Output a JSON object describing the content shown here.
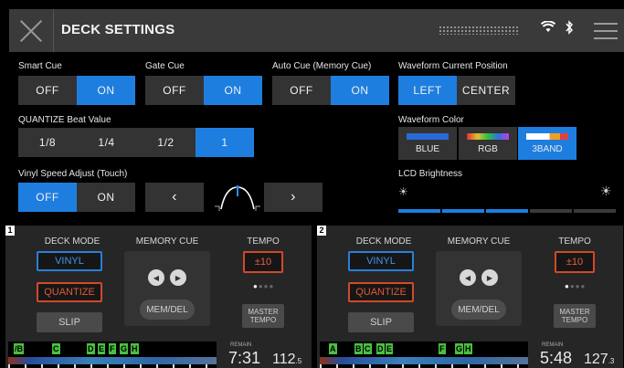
{
  "header": {
    "title": "DECK SETTINGS",
    "wifi_icon": "wifi-icon",
    "bluetooth_icon": "bluetooth-icon",
    "menu_icon": "menu-icon"
  },
  "settings": {
    "smart_cue": {
      "label": "Smart Cue",
      "options": [
        "OFF",
        "ON"
      ],
      "selected": "ON"
    },
    "gate_cue": {
      "label": "Gate Cue",
      "options": [
        "OFF",
        "ON"
      ],
      "selected": "ON"
    },
    "auto_cue": {
      "label": "Auto Cue (Memory Cue)",
      "options": [
        "OFF",
        "ON"
      ],
      "selected": "ON"
    },
    "waveform_position": {
      "label": "Waveform Current Position",
      "options": [
        "LEFT",
        "CENTER"
      ],
      "selected": "LEFT"
    },
    "quantize": {
      "label": "QUANTIZE Beat Value",
      "options": [
        "1/8",
        "1/4",
        "1/2",
        "1"
      ],
      "selected": "1"
    },
    "waveform_color": {
      "label": "Waveform Color",
      "options": [
        "BLUE",
        "RGB",
        "3BAND"
      ],
      "selected": "3BAND"
    },
    "vinyl_speed": {
      "label": "Vinyl Speed Adjust (Touch)",
      "options": [
        "OFF",
        "ON"
      ],
      "selected": "OFF",
      "prev": "‹",
      "next": "›"
    },
    "lcd_brightness": {
      "label": "LCD Brightness",
      "level": 3,
      "max": 5
    }
  },
  "decks": [
    {
      "number": "1",
      "deck_mode": "DECK MODE",
      "vinyl": "VINYL",
      "quantize": "QUANTIZE",
      "slip": "SLIP",
      "memory_cue": "MEMORY CUE",
      "mem_del": "MEM/DEL",
      "tempo": "TEMPO",
      "tempo_range": "±10",
      "master_tempo": "MASTER TEMPO",
      "remain": "REMAIN",
      "time": "7:31",
      "bpm_main": "112",
      "bpm_dec": ".5",
      "hot_cues": [
        "/B",
        "C",
        "D",
        "E",
        "F",
        "G",
        "H"
      ]
    },
    {
      "number": "2",
      "deck_mode": "DECK MODE",
      "vinyl": "VINYL",
      "quantize": "QUANTIZE",
      "slip": "SLIP",
      "memory_cue": "MEMORY CUE",
      "mem_del": "MEM/DEL",
      "tempo": "TEMPO",
      "tempo_range": "±10",
      "master_tempo": "MASTER TEMPO",
      "remain": "REMAIN",
      "time": "5:48",
      "bpm_main": "127",
      "bpm_dec": ".3",
      "hot_cues": [
        "A",
        "B",
        "C",
        "D",
        "E",
        "F",
        "G",
        "H"
      ]
    }
  ],
  "colors": {
    "accent": "#1e7ee0",
    "off": "#333333",
    "quantize": "#d04a2a",
    "hotcue": "#4ac040"
  }
}
